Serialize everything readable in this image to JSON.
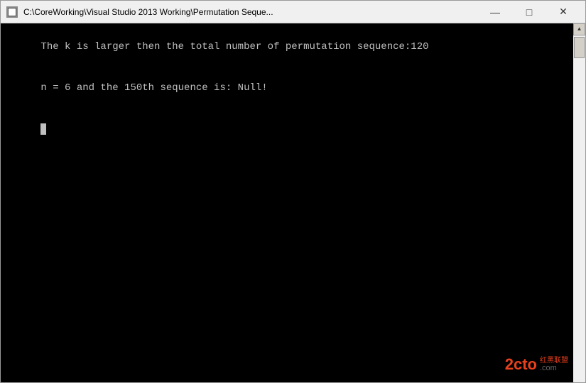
{
  "titleBar": {
    "title": "C:\\CoreWorking\\Visual Studio 2013 Working\\Permutation Seque...",
    "minimizeLabel": "—",
    "maximizeLabel": "□",
    "closeLabel": "✕"
  },
  "console": {
    "line1": "The k is larger then the total number of permutation sequence:120",
    "line2": "n = 6 and the 150th sequence is: Null!"
  },
  "watermark": {
    "logo": "2cto",
    "cn": "红黑联盟",
    "com": ".com"
  }
}
